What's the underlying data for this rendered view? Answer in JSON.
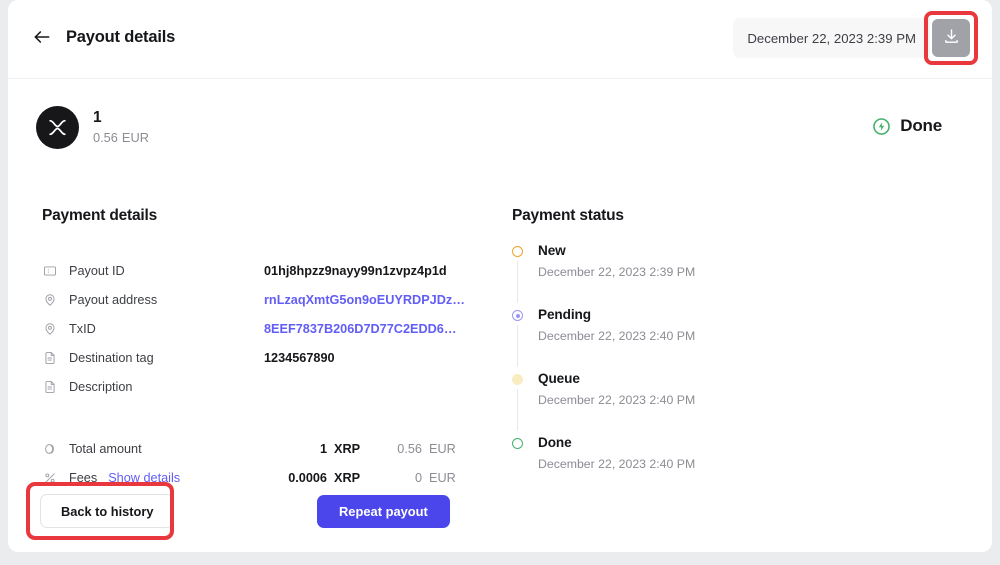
{
  "header": {
    "back_icon": "arrow-left-icon",
    "title": "Payout details",
    "date_value": "December 22, 2023 2:39 PM",
    "download_icon": "download-icon"
  },
  "summary": {
    "coin_icon": "xrp-logo-icon",
    "amount": "1",
    "fiat_amount": "0.56",
    "fiat_currency": "EUR",
    "status_icon": "done-bolt-icon",
    "status_label": "Done"
  },
  "payment_details": {
    "title": "Payment details",
    "rows": [
      {
        "icon": "id-card-icon",
        "label": "Payout ID",
        "value": "01hj8hpzz9nayy99n1zvpz4p1d",
        "is_link": false
      },
      {
        "icon": "pin-icon",
        "label": "Payout address",
        "value": "rnLzaqXmtG5on9oEUYRDPJDz…",
        "is_link": true
      },
      {
        "icon": "pin-icon",
        "label": "TxID",
        "value": "8EEF7837B206D7D77C2EDD6…",
        "is_link": true
      },
      {
        "icon": "document-icon",
        "label": "Destination tag",
        "value": "1234567890",
        "is_link": false
      },
      {
        "icon": "document-icon",
        "label": "Description",
        "value": "",
        "is_link": false
      }
    ],
    "totals": [
      {
        "icon": "coin-icon",
        "label": "Total amount",
        "link_label": "",
        "crypto_amount": "1",
        "crypto_currency": "XRP",
        "fiat_amount": "0.56",
        "fiat_currency": "EUR"
      },
      {
        "icon": "percent-icon",
        "label": "Fees",
        "link_label": "Show details",
        "crypto_amount": "0.0006",
        "crypto_currency": "XRP",
        "fiat_amount": "0",
        "fiat_currency": "EUR"
      }
    ]
  },
  "payment_status": {
    "title": "Payment status",
    "steps": [
      {
        "name": "New",
        "date": "December 22, 2023 2:39 PM",
        "color": "#f0a32a",
        "marker": "ring"
      },
      {
        "name": "Pending",
        "date": "December 22, 2023 2:40 PM",
        "color": "#9b96f2",
        "marker": "filled"
      },
      {
        "name": "Queue",
        "date": "December 22, 2023 2:40 PM",
        "color": "#f3dd8e",
        "marker": "solid"
      },
      {
        "name": "Done",
        "date": "December 22, 2023 2:40 PM",
        "color": "#45b16c",
        "marker": "ring"
      }
    ]
  },
  "footer": {
    "back_label": "Back to history",
    "repeat_label": "Repeat payout"
  },
  "colors": {
    "accent": "#4b46ec",
    "link": "#625df5",
    "highlight": "#e8383d",
    "status_done": "#45b16c"
  }
}
